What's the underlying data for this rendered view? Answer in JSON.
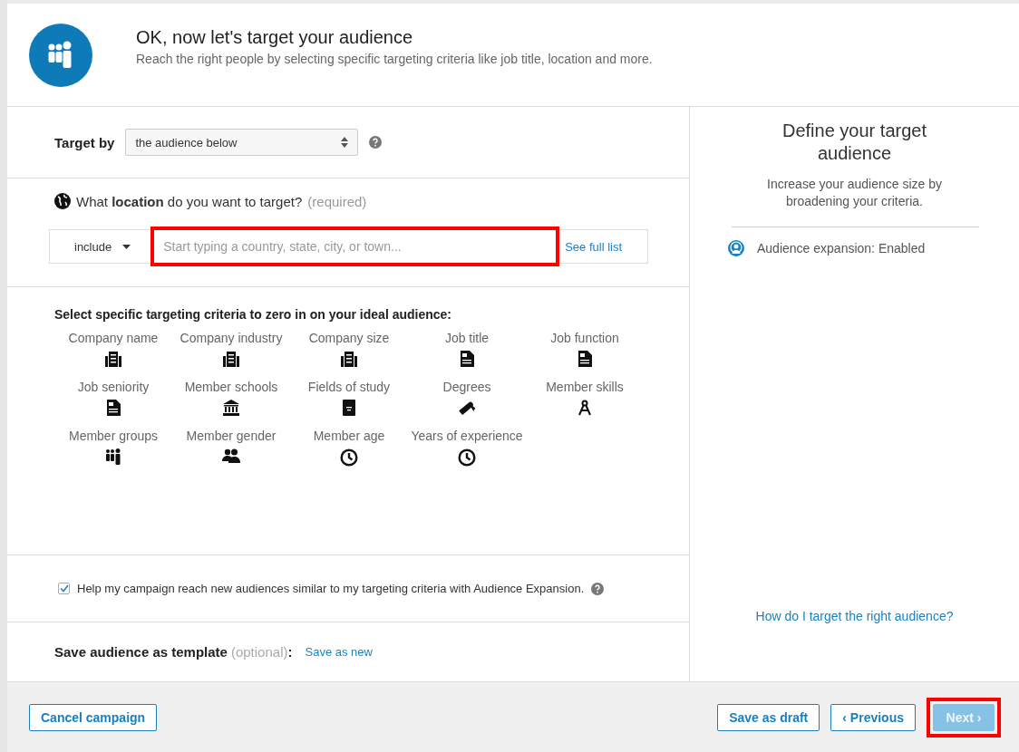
{
  "header": {
    "title": "OK, now let's target your audience",
    "subtitle": "Reach the right people by selecting specific targeting criteria like job title, location and more."
  },
  "target_by": {
    "label": "Target by",
    "value": "the audience below"
  },
  "location": {
    "question": "What **location** do you want to target?",
    "required_note": "(required)",
    "mode": "include",
    "placeholder": "Start typing a country, state, city, or town...",
    "highlighted": true,
    "link": "See full list"
  },
  "criteria": {
    "heading": "Select specific targeting criteria to zero in on your ideal audience:",
    "items": [
      {
        "label": "Company name",
        "kind": "building"
      },
      {
        "label": "Company industry",
        "kind": "building"
      },
      {
        "label": "Company size",
        "kind": "building"
      },
      {
        "label": "Job title",
        "kind": "document"
      },
      {
        "label": "Job function",
        "kind": "document"
      },
      {
        "label": "Job seniority",
        "kind": "document"
      },
      {
        "label": "Member schools",
        "kind": "bank"
      },
      {
        "label": "Fields of study",
        "kind": "book"
      },
      {
        "label": "Degrees",
        "kind": "diploma"
      },
      {
        "label": "Member skills",
        "kind": "compass"
      },
      {
        "label": "Member groups",
        "kind": "group"
      },
      {
        "label": "Member gender",
        "kind": "pair"
      },
      {
        "label": "Member age",
        "kind": "clock"
      },
      {
        "label": "Years of experience",
        "kind": "clock"
      }
    ]
  },
  "expansion": {
    "checked": true,
    "label": "Help my campaign reach new audiences similar to my targeting criteria with Audience Expansion."
  },
  "template": {
    "label": "Save audience as template",
    "optional": "(optional)",
    "colon": ":",
    "link": "Save as new"
  },
  "side": {
    "title": "Define your target audience",
    "text": "Increase your audience size by broadening your criteria.",
    "status": "Audience expansion: Enabled",
    "help_link": "How do I target the right audience?"
  },
  "footer": {
    "cancel": "Cancel campaign",
    "actions": [
      {
        "label": "Save as draft",
        "disabled": false,
        "highlighted": false
      },
      {
        "label": "‹ Previous",
        "disabled": false,
        "highlighted": false
      },
      {
        "label": "Next ›",
        "disabled": true,
        "highlighted": true
      }
    ]
  }
}
